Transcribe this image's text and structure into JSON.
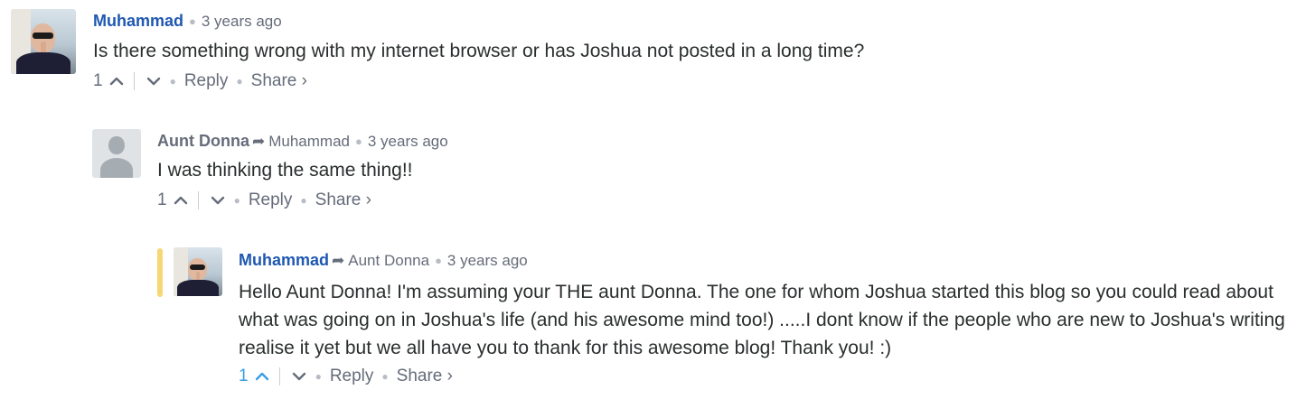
{
  "comments": [
    {
      "author": "Muhammad",
      "reply_to": "",
      "time": "3 years ago",
      "message": "Is there something wrong with my internet browser or has Joshua not posted in a long time?",
      "votes": "1",
      "reply_label": "Reply",
      "share_label": "Share ›",
      "avatar_icon": "user-photo-avatar"
    },
    {
      "author": "Aunt Donna",
      "reply_to": "Muhammad",
      "time": "3 years ago",
      "message": "I was thinking the same thing!!",
      "votes": "1",
      "reply_label": "Reply",
      "share_label": "Share ›",
      "avatar_icon": "default-user-avatar"
    },
    {
      "author": "Muhammad",
      "reply_to": "Aunt Donna",
      "time": "3 years ago",
      "message": "Hello Aunt Donna! I'm assuming your THE aunt Donna. The one for whom Joshua started this blog so you could read about what was going on in Joshua's life (and his awesome mind too!) .....I dont know if the people who are new to Joshua's writing realise it yet but we all have you to thank for this awesome blog! Thank you! :)",
      "votes": "1",
      "reply_label": "Reply",
      "share_label": "Share ›",
      "avatar_icon": "user-photo-avatar"
    }
  ],
  "colors": {
    "author_link": "#1f58b1",
    "author_plain": "#656c7a",
    "active_vote": "#3a9ee6",
    "highlight_bar": "#f7d774"
  }
}
